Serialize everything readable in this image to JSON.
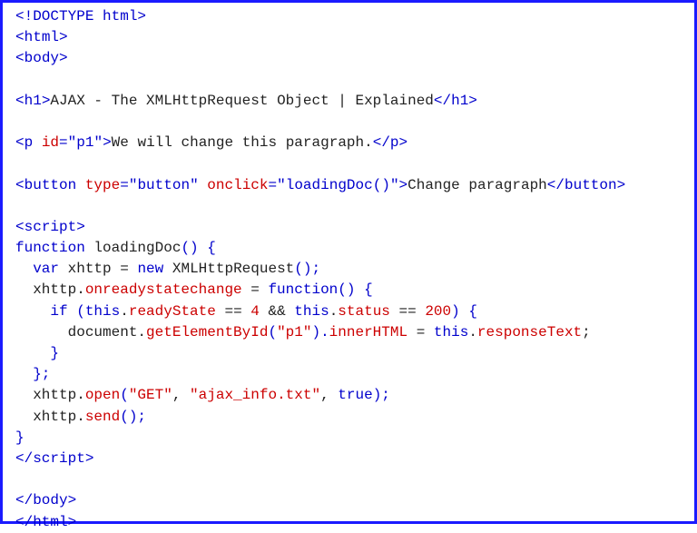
{
  "code": {
    "l1": {
      "open": "<!DOCTYPE html>"
    },
    "l2": {
      "open": "<",
      "tag": "html",
      "close": ">"
    },
    "l3": {
      "open": "<",
      "tag": "body",
      "close": ">"
    },
    "l5": {
      "open": "<",
      "tag": "h1",
      "close": ">",
      "text": "AJAX - The XMLHttpRequest Object | Explained",
      "open2": "</",
      "close2": ">"
    },
    "l7": {
      "open": "<",
      "tag": "p",
      "sp": " ",
      "attr": "id",
      "eq": "=",
      "q1": "\"",
      "val": "p1",
      "q2": "\"",
      "close": ">",
      "text": "We will change this paragraph.",
      "open2": "</",
      "close2": ">"
    },
    "l9": {
      "open": "<",
      "tag": "button",
      "sp": " ",
      "attr1": "type",
      "eq1": "=",
      "q1a": "\"",
      "val1": "button",
      "q1b": "\"",
      "sp2": " ",
      "attr2": "onclick",
      "eq2": "=",
      "q2a": "\"",
      "val2": "loadingDoc()",
      "q2b": "\"",
      "close": ">",
      "text": "Change paragraph",
      "open2": "</",
      "close2": ">"
    },
    "l11": {
      "open": "<",
      "tag": "script",
      "close": ">"
    },
    "l12": {
      "kw": "function",
      "sp": " ",
      "name": "loadingDoc",
      "paren": "() {"
    },
    "l13": {
      "ind": "  ",
      "kw": "var",
      "sp": " ",
      "name": "xhttp = ",
      "kw2": "new",
      "sp2": " ",
      "name2": "XMLHttpRequest",
      "paren": "();"
    },
    "l14": {
      "ind": "  ",
      "name": "xhttp.",
      "prop": "onreadystatechange",
      "eq": " = ",
      "kw": "function",
      "paren": "() {"
    },
    "l15": {
      "ind": "    ",
      "kw": "if",
      "sp": " ",
      "p1": "(",
      "kw2": "this",
      "name": ".",
      "prop": "readyState",
      "eq": " == ",
      "num": "4",
      "and": " && ",
      "kw3": "this",
      "name2": ".",
      "prop2": "status",
      "eq2": " == ",
      "num2": "200",
      "p2": ") {"
    },
    "l16": {
      "ind": "      ",
      "name": "document.",
      "func": "getElementById",
      "p1": "(",
      "lit": "\"p1\"",
      "p2": ").",
      "prop": "innerHTML",
      "eq": " = ",
      "kw": "this",
      "name2": ".",
      "prop2": "responseText",
      "semi": ";"
    },
    "l17": {
      "ind": "    ",
      "brace": "}"
    },
    "l18": {
      "ind": "  ",
      "brace": "};"
    },
    "l19": {
      "ind": "  ",
      "name": "xhttp.",
      "func": "open",
      "p1": "(",
      "lit1": "\"GET\"",
      "comma": ", ",
      "lit2": "\"ajax_info.txt\"",
      "comma2": ", ",
      "bool": "true",
      "p2": ");"
    },
    "l20": {
      "ind": "  ",
      "name": "xhttp.",
      "func": "send",
      "p": "();"
    },
    "l21": {
      "brace": "}"
    },
    "l22": {
      "open": "</",
      "tag": "script",
      "close": ">"
    },
    "l24": {
      "open": "</",
      "tag": "body",
      "close": ">"
    },
    "l25": {
      "open": "</",
      "tag": "html",
      "close": ">"
    }
  }
}
